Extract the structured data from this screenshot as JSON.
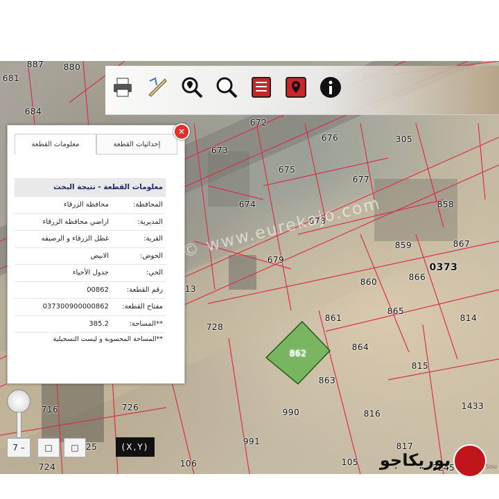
{
  "toolbar": {
    "tools": [
      {
        "icon": "printer-icon"
      },
      {
        "icon": "measure-tool-icon"
      },
      {
        "icon": "zoom-to-location-icon"
      },
      {
        "icon": "search-magnifier-icon"
      },
      {
        "icon": "report-document-icon"
      },
      {
        "icon": "map-pin-icon"
      },
      {
        "icon": "info-icon"
      }
    ]
  },
  "panel": {
    "tabs": {
      "coordinates": "إحداثيات القطعة",
      "info": "معلومات القطعة"
    },
    "header": "معلومات القطعة - نتيجة البحث",
    "rows": [
      {
        "key": "المحافظة:",
        "value": "محافظة الزرقاء"
      },
      {
        "key": "المديرية:",
        "value": "اراضي محافظة الزرقاء"
      },
      {
        "key": "القرية:",
        "value": "غطل الزرقاء و الرصيفه"
      },
      {
        "key": "الحوض:",
        "value": "الابيض"
      },
      {
        "key": "الحي:",
        "value": "جدول الأحياء"
      },
      {
        "key": "رقم القطعة:",
        "value": "00862"
      },
      {
        "key": "مفتاح القطعة:",
        "value": "037300900000862"
      },
      {
        "key": "**المساحة:",
        "value": "385.2"
      }
    ],
    "note": "**المساحة المحسوبة و ليست التسجيلية",
    "close_symbol": "✕"
  },
  "map": {
    "parcels": [
      "887",
      "880",
      "681",
      "684",
      "672",
      "676",
      "305",
      "673",
      "675",
      "677",
      "674",
      "678",
      "858",
      "859",
      "867",
      "679",
      "860",
      "866",
      "13",
      "861",
      "865",
      "728",
      "862",
      "864",
      "814",
      "863",
      "815",
      "716",
      "726",
      "990",
      "816",
      "1433",
      "725",
      "991",
      "817",
      "724",
      "106",
      "105",
      "3245"
    ],
    "block_label": "0373",
    "highlighted_parcel": "862",
    "highlight_color": "#4caf3a"
  },
  "controls": {
    "zoom_minus": "7 –",
    "btn_a": "□",
    "btn_b": "□",
    "xy_label": "(X,Y)"
  },
  "watermark": "© www.eurekajo.com",
  "logo": {
    "text": "بوريكاجو"
  },
  "source_label": "Sou"
}
